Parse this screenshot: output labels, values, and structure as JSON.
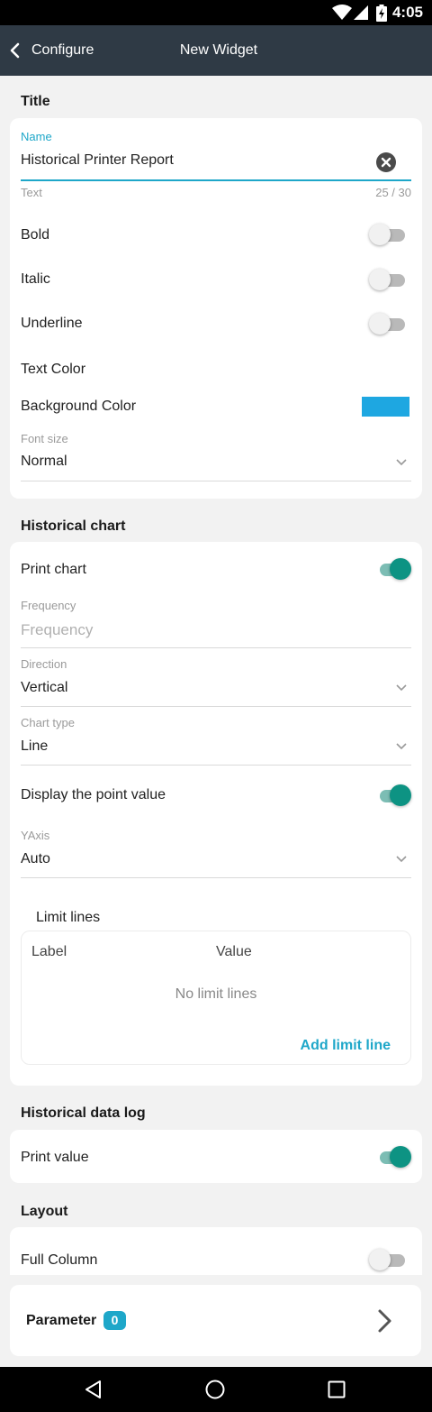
{
  "status_bar": {
    "time": "4:05"
  },
  "toolbar": {
    "back_label": "Configure",
    "title": "New Widget"
  },
  "title_section": {
    "header": "Title",
    "name_label": "Name",
    "name_value": "Historical Printer Report",
    "helper_text": "Text",
    "char_count": "25 / 30",
    "bold_label": "Bold",
    "italic_label": "Italic",
    "underline_label": "Underline",
    "text_color_label": "Text Color",
    "background_color_label": "Background Color",
    "background_color_value": "#1ea7e1",
    "font_size_label": "Font size",
    "font_size_value": "Normal"
  },
  "chart_section": {
    "header": "Historical chart",
    "print_chart_label": "Print chart",
    "frequency_label": "Frequency",
    "frequency_placeholder": "Frequency",
    "direction_label": "Direction",
    "direction_value": "Vertical",
    "chart_type_label": "Chart type",
    "chart_type_value": "Line",
    "display_point_label": "Display the point value",
    "yaxis_label": "YAxis",
    "yaxis_value": "Auto",
    "limit_lines_title": "Limit lines",
    "col_label": "Label",
    "col_value": "Value",
    "empty_text": "No limit lines",
    "add_limit_line": "Add limit line"
  },
  "data_log_section": {
    "header": "Historical data log",
    "print_value_label": "Print value"
  },
  "layout_section": {
    "header": "Layout",
    "full_column_label": "Full Column"
  },
  "parameter": {
    "label": "Parameter",
    "count": "0"
  },
  "colors": {
    "accent": "#1ea7c9",
    "toggle_on": "#0d9383",
    "toolbar": "#2f3a45"
  }
}
